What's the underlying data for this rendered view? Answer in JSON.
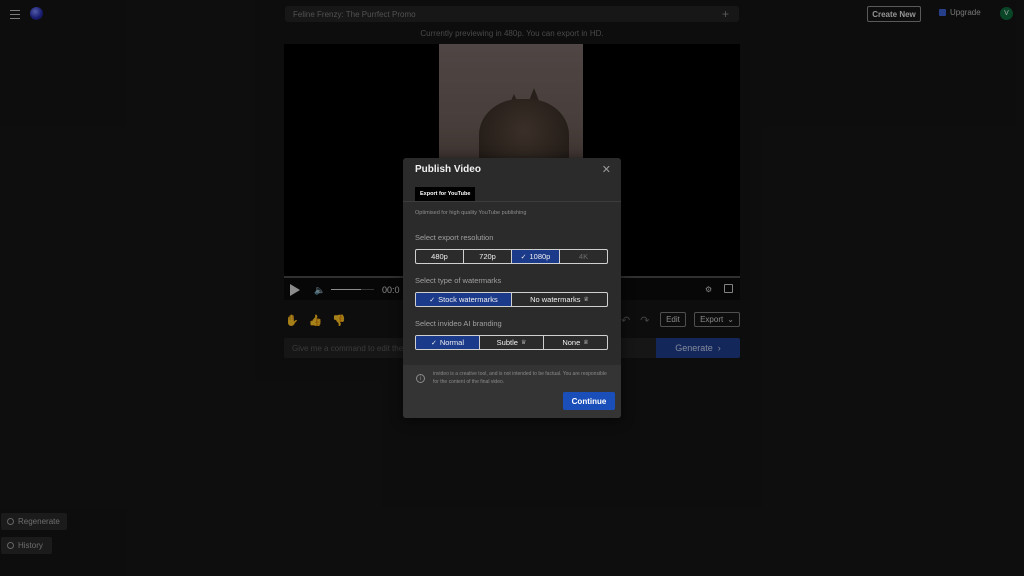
{
  "header": {
    "project_title": "Feline Frenzy: The Purrfect Promo",
    "create_new_label": "Create New",
    "upgrade_label": "Upgrade",
    "avatar_initial": "V"
  },
  "preview_note": "Currently previewing in 480p. You can export in HD.",
  "player": {
    "time": "00:0"
  },
  "actions": {
    "edit_label": "Edit",
    "export_label": "Export"
  },
  "command": {
    "placeholder": "Give me a command to edit the v",
    "generate_label": "Generate"
  },
  "left_panel": {
    "regenerate_label": "Regenerate",
    "history_label": "History"
  },
  "modal": {
    "title": "Publish Video",
    "tab_label": "Export for YouTube",
    "subtitle": "Optimised for high quality YouTube publishing",
    "resolution": {
      "label": "Select export resolution",
      "options": [
        "480p",
        "720p",
        "1080p",
        "4K"
      ],
      "selected": "1080p"
    },
    "watermark": {
      "label": "Select type of watermarks",
      "options": [
        "Stock watermarks",
        "No watermarks"
      ],
      "selected": "Stock watermarks"
    },
    "branding": {
      "label": "Select invideo AI branding",
      "options": [
        "Normal",
        "Subtle",
        "None"
      ],
      "selected": "Normal"
    },
    "disclaimer": "invideo is a creative tool, and is not intended to be factual. You are responsible for the content of the final video.",
    "continue_label": "Continue"
  }
}
